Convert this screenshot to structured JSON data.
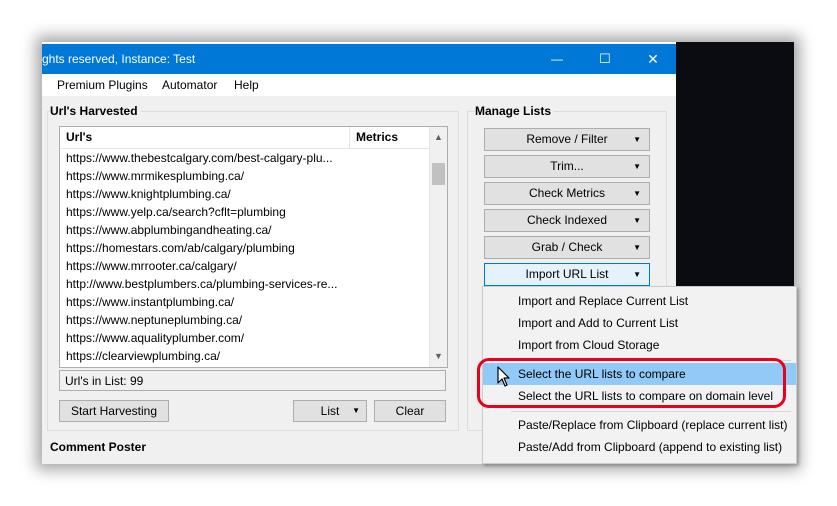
{
  "window": {
    "title": "ghts reserved, Instance: Test",
    "minimize": "—",
    "maximize": "☐",
    "close": "✕"
  },
  "menu": [
    "Premium Plugins",
    "Automator",
    "Help"
  ],
  "harvested": {
    "group_title": "Url's Harvested",
    "col_url": "Url's",
    "col_metrics": "Metrics",
    "rows": [
      "https://www.thebestcalgary.com/best-calgary-plu...",
      "https://www.mrmikesplumbing.ca/",
      "https://www.knightplumbing.ca/",
      "https://www.yelp.ca/search?cflt=plumbing",
      "https://www.abplumbingandheating.ca/",
      "https://homestars.com/ab/calgary/plumbing",
      "https://www.mrrooter.ca/calgary/",
      "http://www.bestplumbers.ca/plumbing-services-re...",
      "https://www.instantplumbing.ca/",
      "https://www.neptuneplumbing.ca/",
      "https://www.aqualityplumber.com/",
      "https://clearviewplumbing.ca/"
    ],
    "count_label": "Url's in List: 99",
    "start_button": "Start Harvesting",
    "list_button": "List",
    "clear_button": "Clear"
  },
  "manage": {
    "group_title": "Manage Lists",
    "buttons": [
      "Remove / Filter",
      "Trim...",
      "Check Metrics",
      "Check Indexed",
      "Grab / Check",
      "Import URL List"
    ]
  },
  "comment_poster": {
    "group_title": "Comment Poster"
  },
  "import_menu": {
    "items": [
      "Import and Replace Current List",
      "Import and Add to Current List",
      "Import from Cloud Storage",
      "Select the URL lists to compare",
      "Select the URL lists to compare on domain level",
      "Paste/Replace from Clipboard (replace current list)",
      "Paste/Add from Clipboard (append to existing list)"
    ]
  },
  "colors": {
    "titlebar": "#0078d7",
    "highlight": "#91c9f7",
    "annotation": "#e8001c"
  }
}
